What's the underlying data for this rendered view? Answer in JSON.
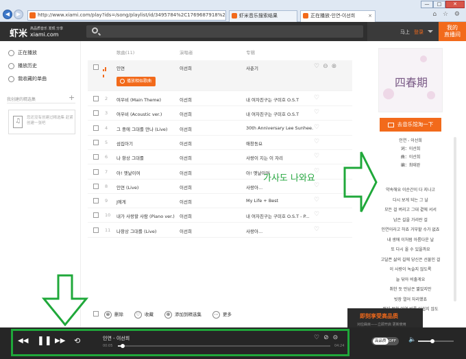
{
  "browser": {
    "url": "http://www.xiami.com/play?ids=/song/playlist/id/3495784%2C1769687918%2C1769...",
    "tabs": [
      {
        "label": "虾米音乐搜索结果"
      },
      {
        "label": "正在播放-인연-이선희",
        "close": "×"
      }
    ],
    "window_buttons": [
      "—",
      "□",
      "✕"
    ],
    "toolbar_icons": "⌂ ☆ ⚙"
  },
  "header": {
    "logo": "虾米",
    "logo_sub": "高品质音乐 发现 分享",
    "logo_en": "xiami.com",
    "user_prefix": "马上",
    "login": "登录",
    "live_button": "我的\n直播间"
  },
  "sidebar": {
    "items": [
      {
        "label": "正在播放",
        "icon": "disc-icon"
      },
      {
        "label": "播放历史",
        "icon": "clock-icon"
      },
      {
        "label": "我收藏的单曲",
        "icon": "heart-icon"
      }
    ],
    "section_title": "我创建的精选集",
    "section_plus": "+",
    "empty_text": "您还没有创建过精选集 赶紧创建一张吧"
  },
  "list": {
    "headers": {
      "title": "歌曲(11)",
      "artist": "演唱者",
      "album": "专辑"
    },
    "current": {
      "title": "인연",
      "artist": "이선희",
      "album": "사춘기",
      "radio_button": "播放相似歌曲"
    },
    "rows": [
      {
        "num": "2",
        "title": "여우비 (Main Theme)",
        "artist": "이선희",
        "album": "내 여자친구는 구미호 O.S.T"
      },
      {
        "num": "3",
        "title": "여우비 (Acoustic ver.)",
        "artist": "이선희",
        "album": "내 여자친구는 구미호 O.S.T"
      },
      {
        "num": "4",
        "title": "그 중에 그대를 만나 (Live)",
        "artist": "이선희",
        "album": "30th Anniversary Lee Sunhee..."
      },
      {
        "num": "5",
        "title": "섬집아기",
        "artist": "이선희",
        "album": "애창동요"
      },
      {
        "num": "6",
        "title": "나 항상 그대를",
        "artist": "이선희",
        "album": "사랑이 지는 이 자리"
      },
      {
        "num": "7",
        "title": "아! 옛날이여",
        "artist": "이선희",
        "album": "아! 옛날이여"
      },
      {
        "num": "8",
        "title": "인연 (Live)",
        "artist": "이선희",
        "album": "사랑아..."
      },
      {
        "num": "9",
        "title": "J에게",
        "artist": "이선희",
        "album": "My Life + Best"
      },
      {
        "num": "10",
        "title": "내가 사랑할 사람 (Piano ver.)",
        "artist": "이선희",
        "album": "내 여자친구는 구미호 O.S.T - P..."
      },
      {
        "num": "11",
        "title": "나항상 그대를 (Live)",
        "artist": "이선희",
        "album": "사랑아..."
      }
    ],
    "actions": [
      {
        "label": "删除",
        "icon": "delete-icon",
        "glyph": "⊗"
      },
      {
        "label": "收藏",
        "icon": "heart-icon",
        "glyph": "♡"
      },
      {
        "label": "添加到精选集",
        "icon": "add-icon",
        "glyph": "⊕"
      },
      {
        "label": "更多",
        "icon": "more-icon",
        "glyph": "⋯"
      }
    ]
  },
  "right_panel": {
    "album_art_text": "四春期",
    "shop_button": "去音乐馆淘一下",
    "lyrics": [
      "인연 - 이선희",
      "词：이선희",
      "曲：이선희",
      "编：최태완",
      "약속해요 이순간이 다 지나고",
      "다시 보게 되는 그 날",
      "모든 걸 버리고 그대 곁에 서서",
      "남은 길을 가리란 걸",
      "인연이라고 하죠 거부할 수가 없죠",
      "내 생애 이처럼 아름다운 날",
      "또 다시 올 수 있을까요",
      "고달픈 삶의 길에 당신은 선물인 걸",
      "이 사랑이 녹슬지 않도록",
      "늘 닦아 비출게요",
      "취한 듯 만남은 짧았지만",
      "빗장 열어 자리했죠",
      "맺지 못한 인연 비록 아쉽지 않도"
    ]
  },
  "promo": {
    "title": "即刻享受高品质",
    "subtitle": "对应曲目——立即开启 更新使用"
  },
  "player": {
    "song": "인연 - 이선희",
    "time_current": "00:05",
    "time_total": "04:24",
    "progress": 0.02,
    "hq_on": "高品质",
    "hq_off": "OFF",
    "volume": 0.4
  },
  "annotation": {
    "text": "가사도 나와요",
    "color": "#1fa83a"
  },
  "colors": {
    "accent": "#f26a1b",
    "header": "#2f2f2f",
    "player": "#262626",
    "annotation": "#1fa83a"
  }
}
